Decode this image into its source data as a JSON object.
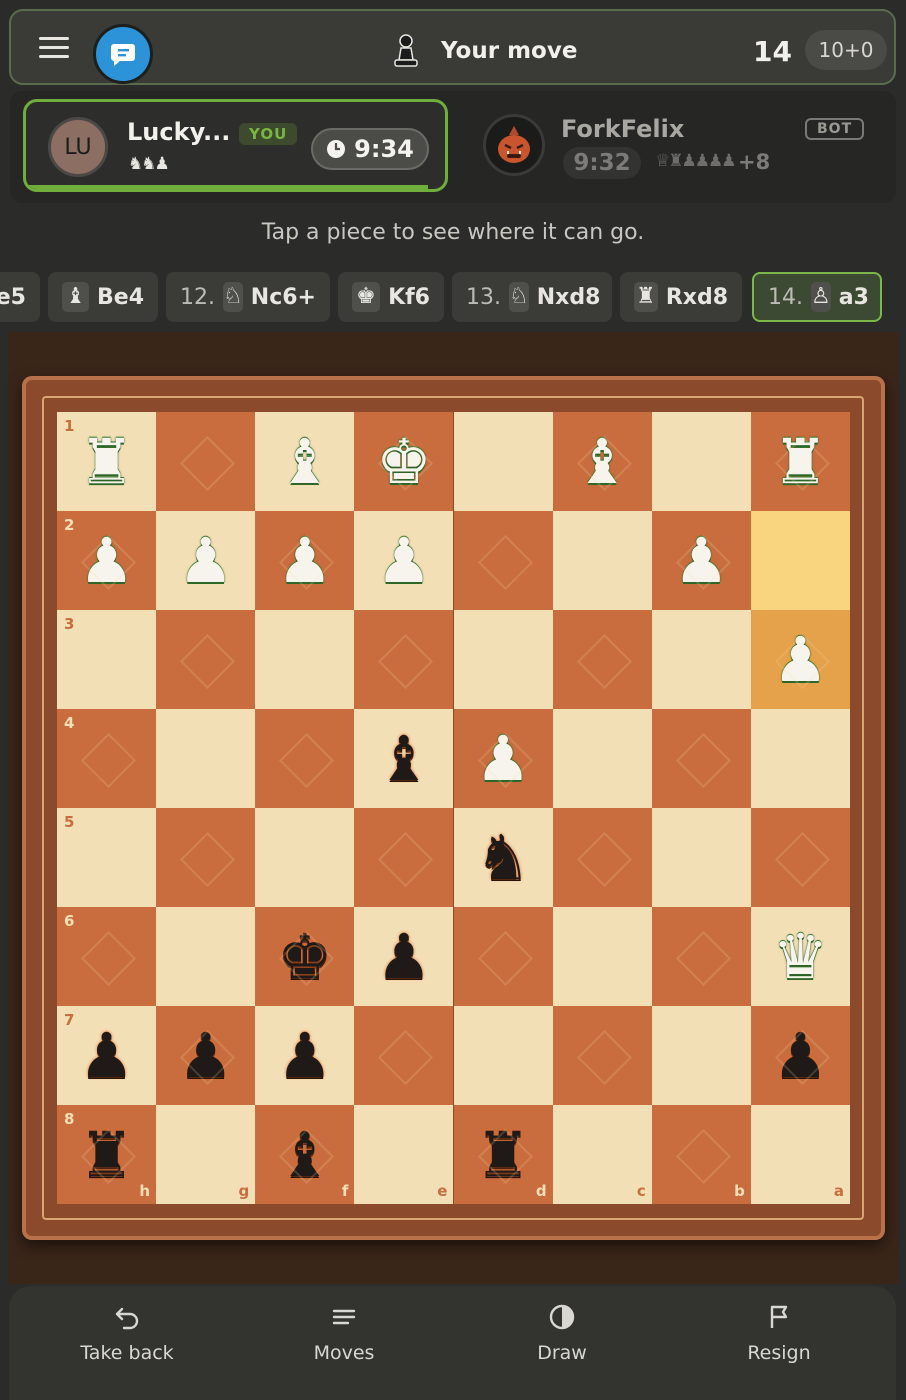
{
  "header": {
    "turn_text": "Your move",
    "move_number": "14",
    "time_control": "10+0",
    "turn_icon": "pawn-icon"
  },
  "me": {
    "initials": "LU",
    "name": "Lucky...",
    "badge": "YOU",
    "clock": "9:34",
    "captured": "♞♞♟",
    "clock_fraction": 0.96
  },
  "opponent": {
    "name": "ForkFelix",
    "badge": "BOT",
    "clock": "9:32",
    "captured": "♕♜♟♟♟♟",
    "advantage": "+8"
  },
  "hint": "Tap a piece to see where it can go.",
  "moves": [
    {
      "num": "",
      "icon": "",
      "san": "e5",
      "partial": true
    },
    {
      "num": "",
      "icon": "♝",
      "san": "Be4"
    },
    {
      "num": "12.",
      "icon": "♘",
      "san": "Nc6+"
    },
    {
      "num": "",
      "icon": "♚",
      "san": "Kf6"
    },
    {
      "num": "13.",
      "icon": "♘",
      "san": "Nxd8"
    },
    {
      "num": "",
      "icon": "♜",
      "san": "Rxd8"
    },
    {
      "num": "14.",
      "icon": "♙",
      "san": "a3",
      "active": true
    }
  ],
  "board": {
    "orientation": "black",
    "rank_labels": [
      "1",
      "2",
      "3",
      "4",
      "5",
      "6",
      "7",
      "8"
    ],
    "file_labels": [
      "h",
      "g",
      "f",
      "e",
      "d",
      "c",
      "b",
      "a"
    ],
    "last_move": {
      "from": "a2",
      "to": "a3"
    },
    "pieces": {
      "h1": "wR",
      "f1": "wB",
      "e1": "wK",
      "c1": "wB",
      "a1": "wR",
      "h2": "wP",
      "g2": "wP",
      "f2": "wP",
      "e2": "wP",
      "b2": "wP",
      "a3": "wP",
      "e4": "bB",
      "d4": "wP",
      "d5": "bN",
      "f6": "bK",
      "e6": "bP",
      "a6": "wQ",
      "h7": "bP",
      "g7": "bP",
      "f7": "bP",
      "a7": "bP",
      "h8": "bR",
      "f8": "bB",
      "d8": "bR"
    }
  },
  "nav": [
    {
      "label": "Take back",
      "icon": "undo-icon"
    },
    {
      "label": "Moves",
      "icon": "list-icon"
    },
    {
      "label": "Draw",
      "icon": "half-circle-icon"
    },
    {
      "label": "Resign",
      "icon": "flag-icon"
    }
  ]
}
